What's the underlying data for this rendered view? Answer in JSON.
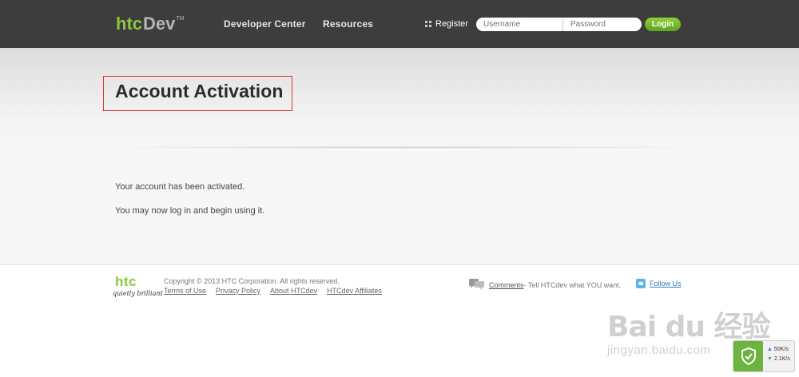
{
  "header": {
    "logo": {
      "htc": "htc",
      "dev": "Dev",
      "tm": "TM"
    },
    "nav": [
      {
        "label": "Developer Center"
      },
      {
        "label": "Resources"
      }
    ],
    "register_label": "Register",
    "username_placeholder": "Username",
    "password_placeholder": "Password",
    "login_label": "Login"
  },
  "page": {
    "title": "Account Activation",
    "messages": [
      "Your account has been activated.",
      "You may now log in and begin using it."
    ]
  },
  "footer": {
    "logo_text": "htc",
    "slogan": "quietly brilliant",
    "copyright": "Copyright © 2013 HTC Corporation. All rights reserved.",
    "links": [
      {
        "label": "Terms of Use"
      },
      {
        "label": "Privacy Policy"
      },
      {
        "label": "About HTCdev"
      },
      {
        "label": "HTCdev Affiliates"
      }
    ],
    "comments_label": "Comments",
    "comments_text": " - Tell HTCdev what YOU want.",
    "follow_label": "Follow Us"
  },
  "speed_widget": {
    "upload": "50K/s",
    "download": "2.1K/s"
  },
  "watermark": {
    "main": "Bai du 经验",
    "sub": "jingyan.baidu.com"
  },
  "colors": {
    "header_bg": "#3d3d3d",
    "brand_green": "#8cc63f",
    "title_frame": "#d9362b",
    "link_blue": "#3b7bbf"
  }
}
